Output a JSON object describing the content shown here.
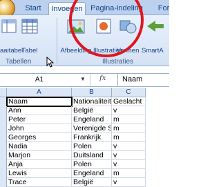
{
  "ribbon": {
    "tabs": [
      "Start",
      "Invoegen",
      "Pagina-indeling",
      "For"
    ],
    "buttons": {
      "draaitabel": "aaitabel",
      "tabel": "Tabel",
      "afbeelding": "Afbeelding",
      "illustraties": "Illustraties",
      "vormen": "Vormen",
      "smartart": "SmartA"
    },
    "groups": {
      "tabellen": "Tabellen",
      "illustraties": "Illustraties"
    }
  },
  "formula_bar": {
    "name_box": "A1",
    "fx": "fx",
    "value": "Naam"
  },
  "sheet": {
    "columns": [
      "A",
      "B",
      "C"
    ],
    "rows": [
      [
        "Naam",
        "Nationaliteit",
        "Geslacht"
      ],
      [
        "Ann",
        "België",
        "v"
      ],
      [
        "Peter",
        "Engeland",
        "m"
      ],
      [
        "John",
        "Verenigde S",
        "m"
      ],
      [
        "Georges",
        "Frankrijk",
        "m"
      ],
      [
        "Nadia",
        "Polen",
        "v"
      ],
      [
        "Marjon",
        "Duitsland",
        "v"
      ],
      [
        "Anja",
        "Polen",
        "v"
      ],
      [
        "Lewis",
        "Engeland",
        "m"
      ],
      [
        "Trace",
        "België",
        "v"
      ]
    ]
  },
  "colors": {
    "annotation": "#e0161e",
    "ribbon_text": "#15428b"
  }
}
